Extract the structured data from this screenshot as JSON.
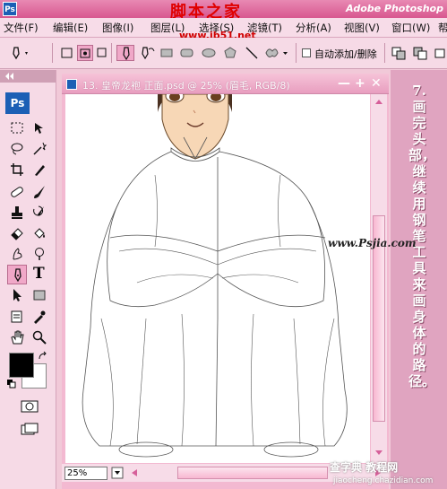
{
  "window": {
    "app_title": "Adobe Photoshop",
    "watermark_title": "脚本之家",
    "watermark_url": "www.jb51.net",
    "ps_logo": "Ps"
  },
  "menu": {
    "items": [
      "文件(F)",
      "编辑(E)",
      "图像(I)",
      "图层(L)",
      "选择(S)",
      "滤镜(T)",
      "分析(A)",
      "视图(V)",
      "窗口(W)",
      "帮"
    ]
  },
  "options": {
    "auto_add_delete_label": "自动添加/删除"
  },
  "toolbox": {
    "logo": "Ps",
    "type_tool_glyph": "T"
  },
  "document": {
    "title": "13. 皇帝龙袍 正面.psd @ 25% (眉毛, RGB/8)",
    "zoom": "25%"
  },
  "caption": {
    "text": "7.画完头部，继续用钢笔工具来画身体的路径。",
    "site_url": "www.Psjia.com"
  },
  "bottom_watermark": {
    "line1": "查字典 教程网",
    "line2": "jiaocheng.chazidian.com"
  },
  "colors": {
    "title_bar": "#d8578f",
    "panel_bg": "#f6dae6",
    "active_tool": "#f0a8c8",
    "ps_blue": "#1c5fb5"
  }
}
